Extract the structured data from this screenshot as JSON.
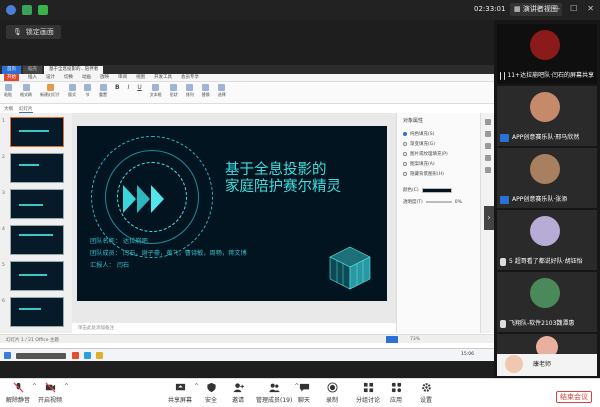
{
  "topbar": {
    "time": "02:33:01",
    "view_label": "演讲者视图",
    "view_caret": "⋮"
  },
  "share": {
    "pill_label": "锁定画面"
  },
  "wps": {
    "tabs": [
      "首页",
      "稻壳",
      "基于全息投影的...陪伴者"
    ],
    "menu": [
      "开始",
      "插入",
      "设计",
      "切换",
      "动画",
      "放映",
      "审阅",
      "视图",
      "开发工具",
      "会员专享"
    ],
    "ribbon": [
      "粘贴",
      "格式刷",
      "新建幻灯片",
      "版式",
      "节",
      "重置",
      "B",
      "I",
      "U",
      "文本框",
      "形状",
      "排列",
      "替换",
      "选择"
    ],
    "panel_tabs": [
      "大纲",
      "幻灯片"
    ],
    "slide": {
      "title_line1": "基于全息投影的",
      "title_line2": "家庭陪护赛尔精灵",
      "team_name": "团队名称：  达拉崩吧",
      "team_members": "团队成员：  闫石，谢子豪，黄飞，曹诗敏，周畅，蒋文博",
      "reporter": "汇报人：    闫石"
    },
    "notes_placeholder": "单击此处添加备注",
    "properties": {
      "header": "对象属性",
      "options": [
        "纯色填充(S)",
        "渐变填充(G)",
        "图片或纹理填充(P)",
        "图案填充(A)",
        "隐藏背景图形(H)"
      ],
      "transparency_label": "透明度(T)",
      "transparency_value": "0%",
      "color_label": "颜色(C)"
    },
    "status": {
      "left": "幻灯片 1 / 21   Office 主题",
      "zoom": "73%"
    },
    "clock": "15:06"
  },
  "participants": [
    {
      "name": "11+达拉崩吧队·闫石的屏幕共享",
      "avatar": "#8b1a1a"
    },
    {
      "name": "APP创意赛乐队·邢马欣然",
      "avatar": "#c48a6a"
    },
    {
      "name": "APP创意赛乐队·张添",
      "avatar": "#a88060"
    },
    {
      "name": "5 超哥看了都说好队·胡钰怡",
      "avatar": "#b7acd6"
    },
    {
      "name": "飞翔队-软件2103魏潭惠",
      "avatar": "#4a8a5a"
    },
    {
      "name": "",
      "avatar": "#e9b0a0"
    },
    {
      "name": "康老师",
      "avatar": "#f0c8b0"
    }
  ],
  "toolbar": {
    "mute": "解除静音",
    "video": "开启视频",
    "share": "共享屏幕",
    "security": "安全",
    "invite": "邀请",
    "members": "管理成员(19)",
    "chat": "聊天",
    "record": "录制",
    "breakout": "分组讨论",
    "apps": "应用",
    "settings": "设置",
    "end": "结束会议"
  },
  "colors": {
    "accent": "#2c70d6",
    "slide_bg": "#031421",
    "slide_cyan": "#3ae0e0",
    "end_red": "#e0403c"
  }
}
